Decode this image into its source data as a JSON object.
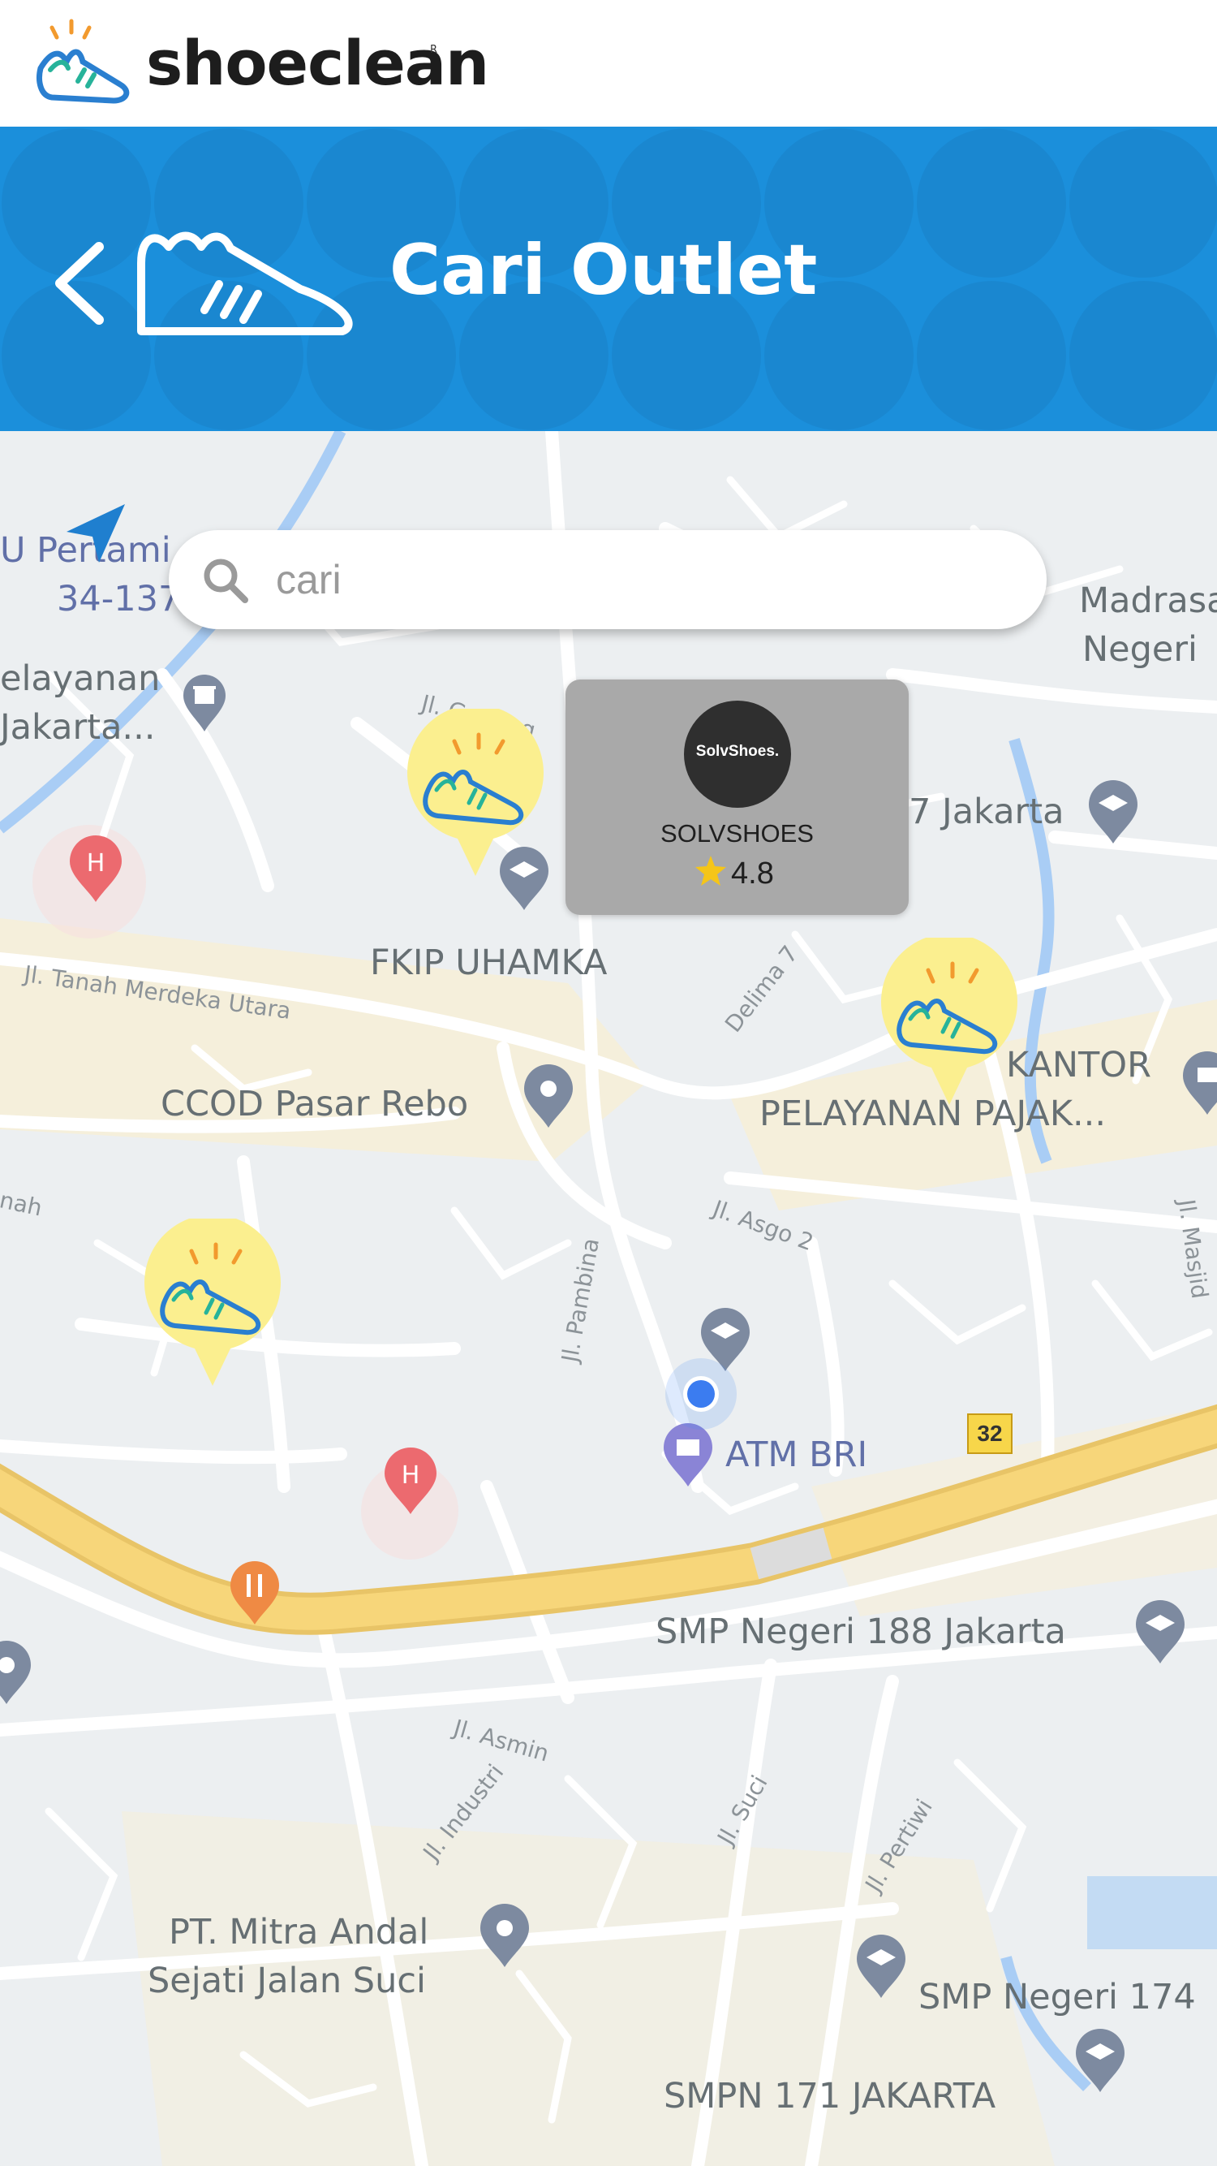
{
  "brand": {
    "name": "shoeclean",
    "reg_mark": "R"
  },
  "header": {
    "title": "Cari Outlet"
  },
  "search": {
    "placeholder": "cari",
    "value": ""
  },
  "outlet_card": {
    "logo_text": "SolvShoes.",
    "name": "SOLVSHOES",
    "rating": "4.8"
  },
  "map_labels": {
    "p1": "U Pertami",
    "p1b": "34-137",
    "p2": "elayanan",
    "p2b": "Jakarta...",
    "p3": "Madrasa",
    "p3b": "Negeri",
    "p4": "7 Jakarta",
    "p5": "FKIP UHAMKA",
    "p6": "KANTOR",
    "p6b": "PELAYANAN PAJAK...",
    "p7": "CCOD Pasar Rebo",
    "p8": "ATM BRI",
    "p9": "SMP Negeri 188 Jakarta",
    "p10": "PT. Mitra Andal",
    "p10b": "Sejati Jalan Suci",
    "p11": "SMP Negeri 174",
    "p12": "SMPN 171 JAKARTA",
    "route_number": "32"
  },
  "road_labels": {
    "r1": "Jl. Gudang",
    "r2": "Jl. Tanah Merdeka Utara",
    "r3": "Delima 7",
    "r4": "Jl. Asgo 2",
    "r5": "Jl. Pambina",
    "r6": "Jl. Masjid",
    "r7": "Jl. Asmin",
    "r8": "Jl. Industri",
    "r9": "Jl. Suci",
    "r10": "Jl. Pertiwi",
    "r11": "nah"
  },
  "colors": {
    "header_blue": "#1b8fdb",
    "marker_yellow": "#fbef8f",
    "road_yellow": "#f6d87e"
  },
  "icons": {
    "back": "chevron-left-icon",
    "search": "magnifier-icon",
    "locate": "navigation-arrow-icon",
    "marker": "shoe-marker-icon",
    "rating": "star-icon"
  }
}
